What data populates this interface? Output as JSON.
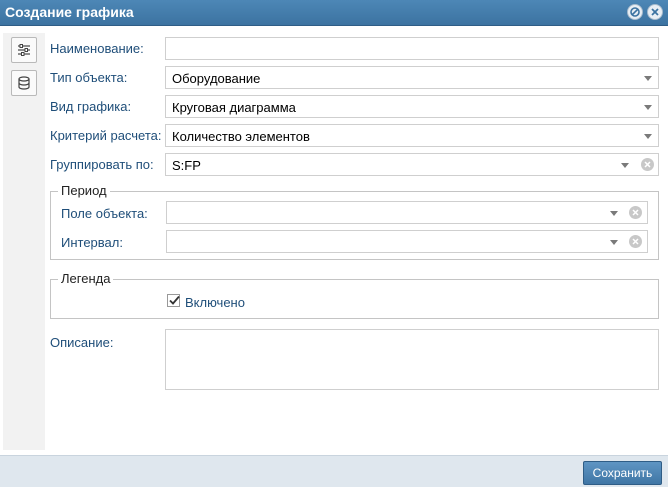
{
  "window": {
    "title": "Создание графика"
  },
  "form": {
    "name": {
      "label": "Наименование:",
      "value": ""
    },
    "object_type": {
      "label": "Тип объекта:",
      "value": "Оборудование"
    },
    "chart_type": {
      "label": "Вид графика:",
      "value": "Круговая диаграмма"
    },
    "criterion": {
      "label": "Критерий расчета:",
      "value": "Количество элементов"
    },
    "group_by": {
      "label": "Группировать по:",
      "value": "S:FP"
    },
    "period": {
      "title": "Период",
      "object_field": {
        "label": "Поле объекта:",
        "value": ""
      },
      "interval": {
        "label": "Интервал:",
        "value": ""
      }
    },
    "legend": {
      "title": "Легенда",
      "enabled_label": "Включено",
      "enabled": true
    },
    "description": {
      "label": "Описание:",
      "value": ""
    }
  },
  "footer": {
    "save_label": "Сохранить"
  },
  "colors": {
    "titlebar": "#3f76a5",
    "label": "#1f4e79",
    "footer": "#dfe7ee"
  }
}
